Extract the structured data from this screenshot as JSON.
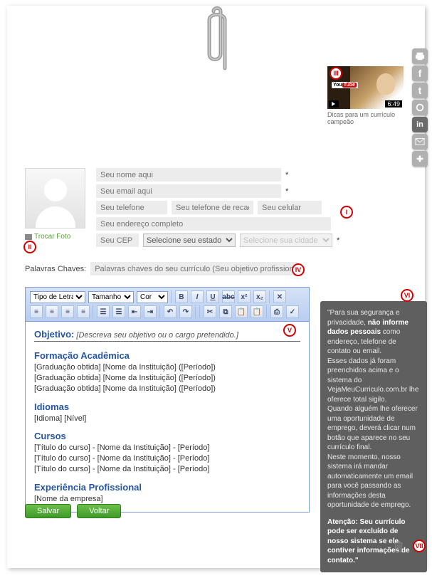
{
  "video": {
    "caption": "Dicas para um currículo campeão",
    "youtube": "You",
    "tube": "Tube",
    "duration": "6:49"
  },
  "photo": {
    "swap_label": "Trocar Foto"
  },
  "fields": {
    "name_ph": "Seu nome aqui",
    "email_ph": "Seu email aqui",
    "phone_ph": "Seu telefone",
    "alt_phone_ph": "Seu telefone de recado",
    "cell_ph": "Seu celular",
    "address_ph": "Seu endereço completo",
    "cep_ph": "Seu CEP",
    "state_ph": "Selecione seu estado",
    "city_ph": "Selecione sua cidade",
    "asterisk": "*"
  },
  "keywords": {
    "label": "Palavras Chaves:",
    "placeholder": "Palavras chaves do seu currículo (Seu objetivo profissional)"
  },
  "toolbar": {
    "font_label": "Tipo de Letra",
    "size_label": "Tamanho",
    "color_label": "Cor"
  },
  "editor": {
    "objetivo_h": "Objetivo:",
    "objetivo_desc": "[Descreva seu objetivo ou o cargo pretendido.]",
    "formacao_h": "Formação Acadêmica",
    "formacao_lines": [
      "[Graduação obtida] [Nome da Instituição] ([Período])",
      "[Graduação obtida] [Nome da Instituição] ([Período])",
      "[Graduação obtida] [Nome da Instituição] ([Período])"
    ],
    "idiomas_h": "Idiomas",
    "idiomas_line": "[Idioma] [Nível]",
    "cursos_h": "Cursos",
    "cursos_lines": [
      "[Título do curso] - [Nome da Instituição] - [Período]",
      "[Título do curso] - [Nome da Instituição] - [Período]",
      "[Título do curso] - [Nome da Instituição] - [Período]"
    ],
    "exp_h": "Experiência Profissional",
    "exp_line": "[Nome da empresa]"
  },
  "actions": {
    "save": "Salvar",
    "back": "Voltar"
  },
  "tip": {
    "p1a": "\"Para sua segurança e privacidade, ",
    "p1b": "não informe dados pessoais",
    "p1c": " como endereço, telefone de contato ou email.",
    "p2": "Esses dados já foram preenchidos acima e o sistema do VejaMeuCurriculo.com.br lhe oferece total sigilo.",
    "p3": "Quando alguém lhe oferecer uma oportunidade de emprego, deverá clicar num botão que aparece no seu currículo final.",
    "p4": "Neste momento, nosso sistema irá mandar automaticamente um email para você passando as informações desta oportunidade de emprego.",
    "warn": "Atenção: Seu currículo pode ser excluído de nosso sistema se ele contiver informações de contato.\""
  },
  "markers": {
    "i": "I",
    "ii": "II",
    "iii": "III",
    "iv": "IV",
    "v": "V",
    "vi": "VI",
    "vii": "VII"
  }
}
